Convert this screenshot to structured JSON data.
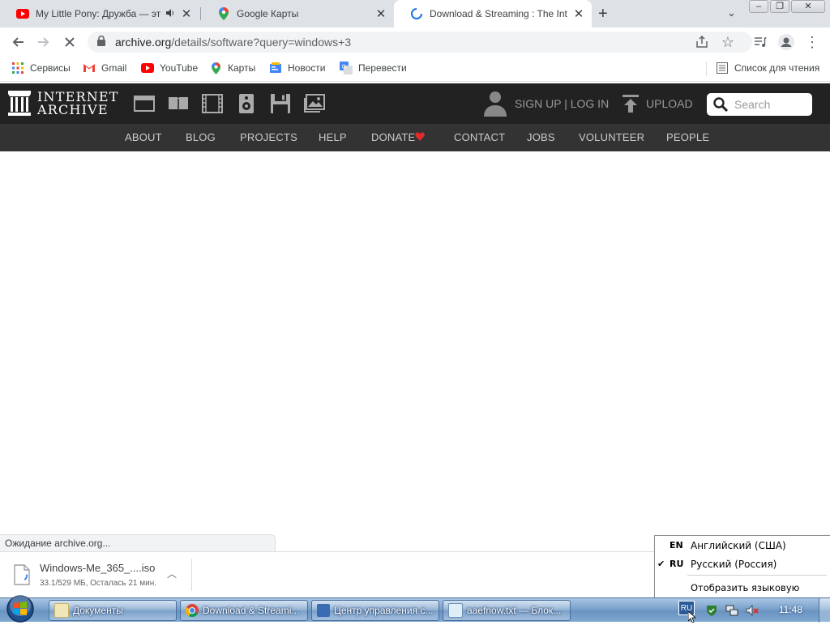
{
  "browser": {
    "tabs": [
      {
        "title": "My Little Pony: Дружба — это чудо",
        "active": false,
        "icon": "youtube-icon",
        "muted_indicator": "speaker-icon"
      },
      {
        "title": "Google Карты",
        "active": false,
        "icon": "google-maps-icon"
      },
      {
        "title": "Download & Streaming : The Internet Archive",
        "active": true,
        "icon": "loading-spinner-icon"
      }
    ],
    "new_tab_symbol": "+",
    "url": {
      "host": "archive.org",
      "path": "/details/software?query=windows+3"
    },
    "bookmarks": [
      {
        "label": "Сервисы",
        "icon": "apps-grid-icon"
      },
      {
        "label": "Gmail",
        "icon": "gmail-icon"
      },
      {
        "label": "YouTube",
        "icon": "youtube-icon"
      },
      {
        "label": "Карты",
        "icon": "google-maps-icon"
      },
      {
        "label": "Новости",
        "icon": "news-icon"
      },
      {
        "label": "Перевести",
        "icon": "translate-icon"
      }
    ],
    "reading_list": "Список для чтения",
    "status_text": "Ожидание archive.org..."
  },
  "archive": {
    "logo_line1": "INTERNET",
    "logo_line2": "ARCHIVE",
    "sign_up_login": "SIGN UP | LOG IN",
    "upload": "UPLOAD",
    "search_placeholder": "Search",
    "nav": [
      "ABOUT",
      "BLOG",
      "PROJECTS",
      "HELP",
      "DONATE",
      "CONTACT",
      "JOBS",
      "VOLUNTEER",
      "PEOPLE"
    ],
    "media_icons": [
      "web-icon",
      "texts-icon",
      "video-icon",
      "audio-icon",
      "software-icon",
      "images-icon"
    ]
  },
  "download": {
    "filename": "Windows-Me_365_....iso",
    "progress": "33.1/529 МБ, Осталась 21 мин."
  },
  "language_popup": {
    "items": [
      {
        "code": "EN",
        "name": "Английский (США)",
        "checked": false
      },
      {
        "code": "RU",
        "name": "Русский (Россия)",
        "checked": true
      }
    ],
    "show_bar": "Отобразить языковую панель"
  },
  "taskbar": {
    "items": [
      {
        "label": "Документы"
      },
      {
        "label": "Download & Streami..."
      },
      {
        "label": "Центр управления с..."
      },
      {
        "label": "aaefnow.txt — Блок..."
      }
    ],
    "lang_indicator": "RU",
    "clock": "11:48"
  },
  "colors": {
    "ia_dark": "#222222",
    "ia_nav": "#333333",
    "donate_heart": "#e02b2b",
    "link_blue": "#1a73e8"
  }
}
